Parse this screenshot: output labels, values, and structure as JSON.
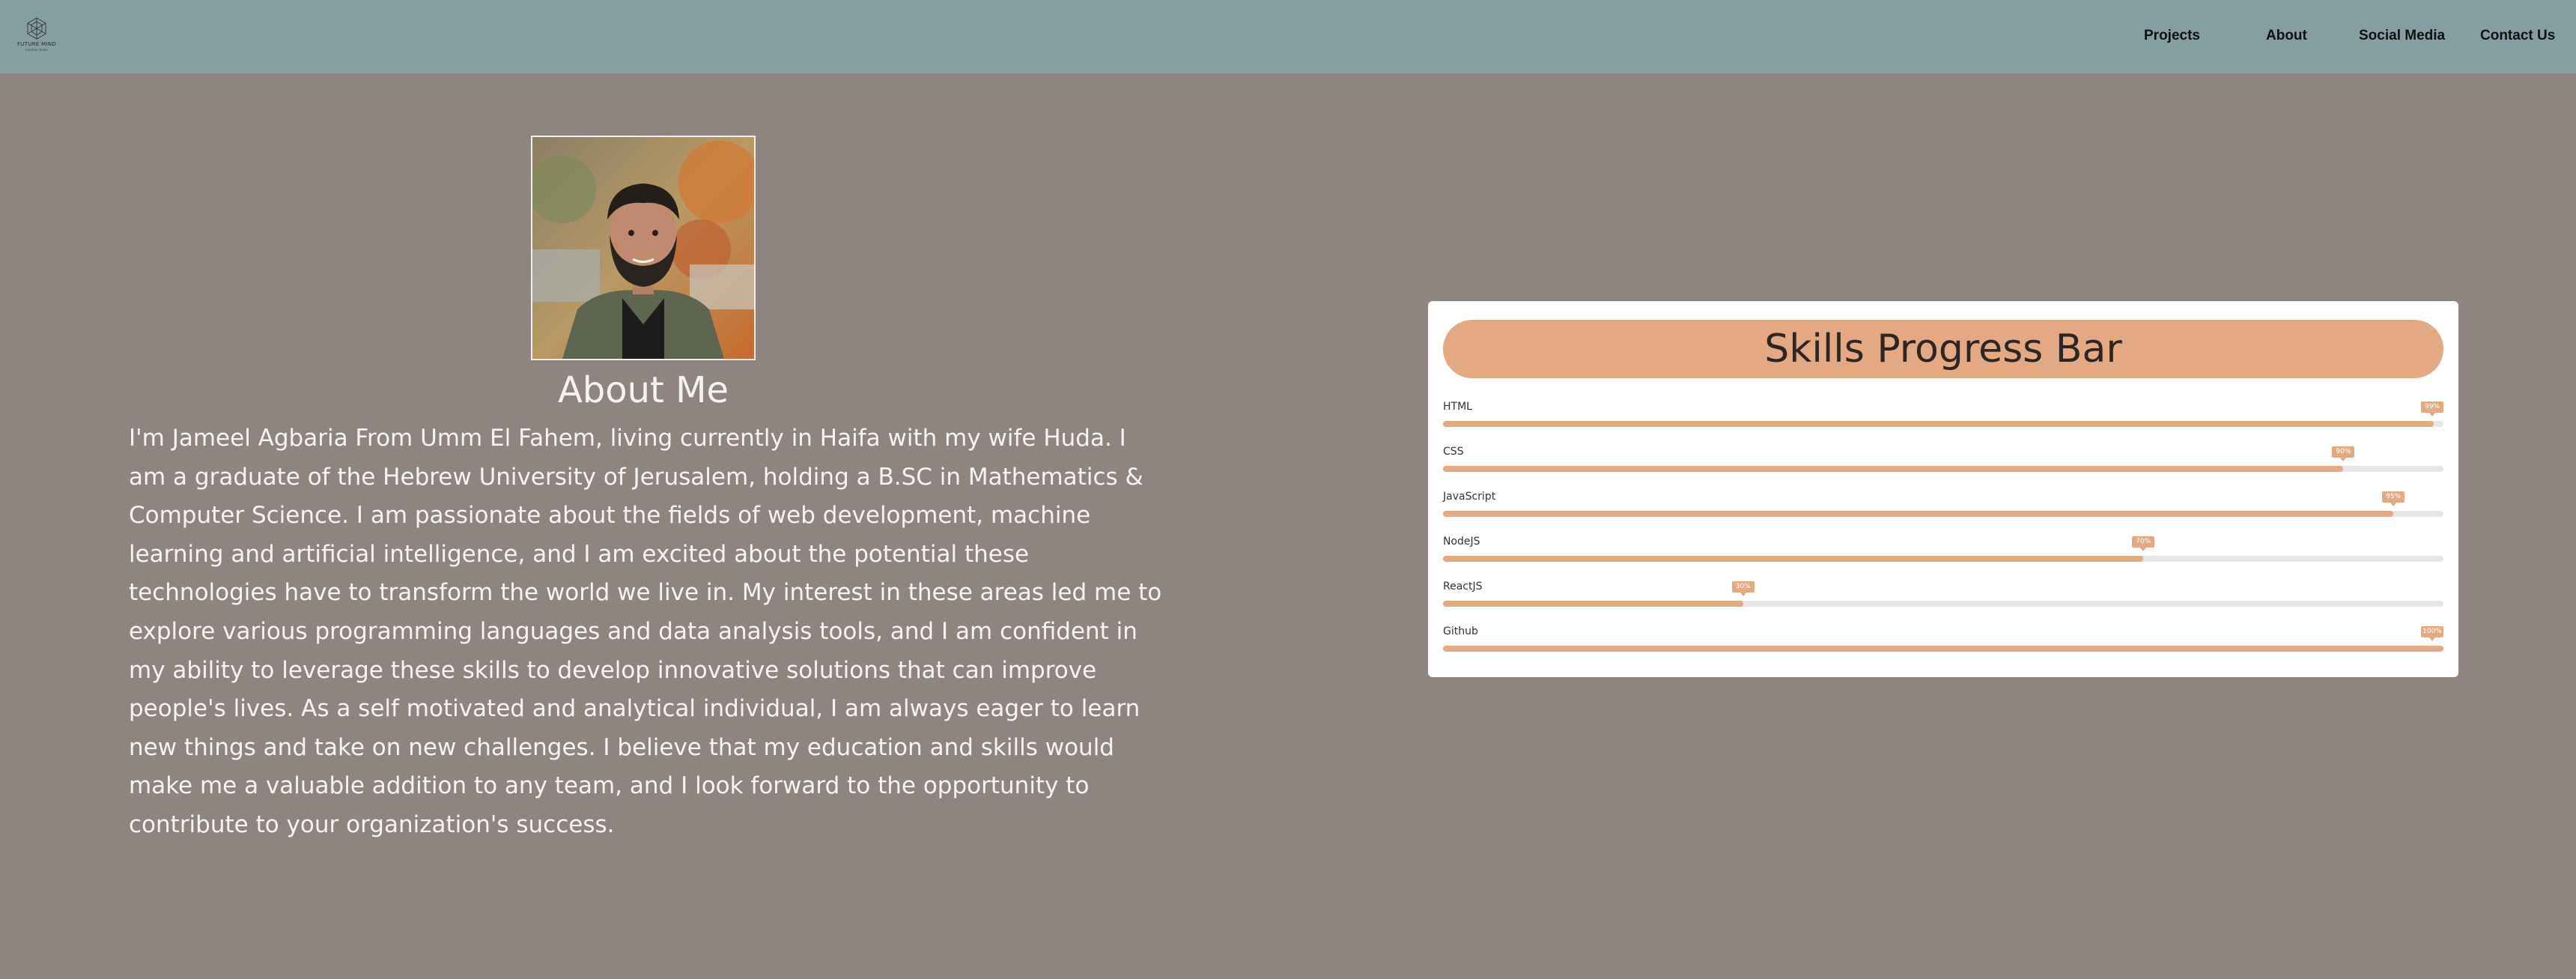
{
  "nav": {
    "logo": {
      "name": "FUTURE MIND",
      "tagline": "creative studio"
    },
    "links": [
      "Projects",
      "About",
      "Social Media",
      "Contact Us"
    ]
  },
  "about": {
    "photo_alt": "Portrait photo",
    "title": "About Me",
    "text": "I'm Jameel Agbaria From Umm El Fahem, living currently in Haifa with my wife Huda. I am a graduate of the Hebrew University of Jerusalem, holding a B.SC in Mathematics & Computer Science. I am passionate about the fields of web development, machine learning and artificial intelligence, and I am excited about the potential these technologies have to transform the world we live in. My interest in these areas led me to explore various programming languages and data analysis tools, and I am confident in my ability to leverage these skills to develop innovative solutions that can improve people's lives. As a self motivated and analytical individual, I am always eager to learn new things and take on new challenges. I believe that my education and skills would make me a valuable addition to any team, and I look forward to the opportunity to contribute to your organization's success."
  },
  "skills": {
    "title": "Skills Progress Bar",
    "items": [
      {
        "name": "HTML",
        "percent": 99,
        "badge": "99%"
      },
      {
        "name": "CSS",
        "percent": 90,
        "badge": "90%"
      },
      {
        "name": "JavaScript",
        "percent": 95,
        "badge": "95%"
      },
      {
        "name": "NodeJS",
        "percent": 70,
        "badge": "70%"
      },
      {
        "name": "ReactJS",
        "percent": 30,
        "badge": "30%"
      },
      {
        "name": "Github",
        "percent": 100,
        "badge": "100%"
      }
    ]
  },
  "colors": {
    "navbar": "#859ea1",
    "background": "#8e8480",
    "accent": "#e3a982",
    "track": "#e6e6e6"
  }
}
